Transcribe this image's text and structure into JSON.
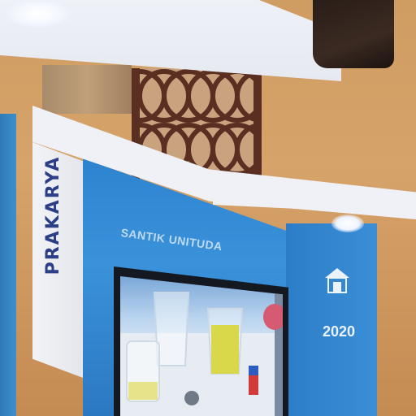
{
  "scene": {
    "signboard_label": "PRAKARYA",
    "booth_title": "SANTIK UNITUDA",
    "year": "2020"
  },
  "colors": {
    "booth_blue": "#3a92da",
    "signboard_text": "#2b3f86",
    "wall": "#d6a36a",
    "lattice": "#5a2f22"
  }
}
